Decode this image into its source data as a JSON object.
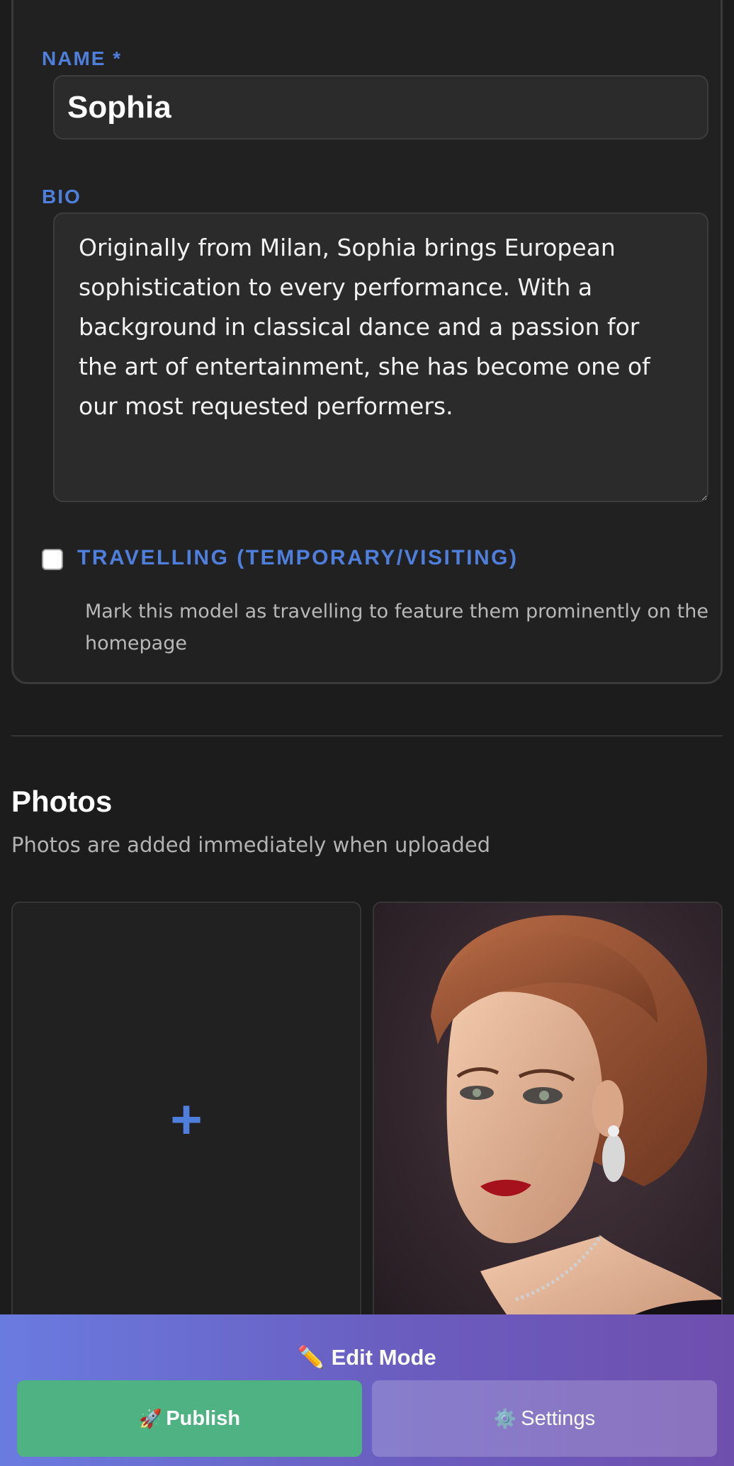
{
  "form": {
    "name_label": "NAME *",
    "name_value": "Sophia",
    "bio_label": "BIO",
    "bio_value": "Originally from Milan, Sophia brings European sophistication to every performance. With a background in classical dance and a passion for the art of entertainment, she has become one of our most requested performers.",
    "travelling_label": "TRAVELLING (TEMPORARY/VISITING)",
    "travelling_checked": false,
    "travelling_help": "Mark this model as travelling to feature them prominently on the homepage"
  },
  "photos": {
    "title": "Photos",
    "subtitle": "Photos are added immediately when uploaded",
    "add_icon": "plus-icon",
    "items": [
      {
        "icon": "portrait-photo"
      }
    ]
  },
  "edit_bar": {
    "title_icon": "pencil-icon",
    "title": "Edit Mode",
    "publish_icon": "rocket-icon",
    "publish_label": "Publish",
    "settings_icon": "gear-icon",
    "settings_label": "Settings"
  },
  "colors": {
    "accent": "#4f7fdc",
    "publish": "#4fb282",
    "bar_gradient_start": "#6a7be0",
    "bar_gradient_end": "#6f4fae",
    "background": "#1c1c1c"
  }
}
